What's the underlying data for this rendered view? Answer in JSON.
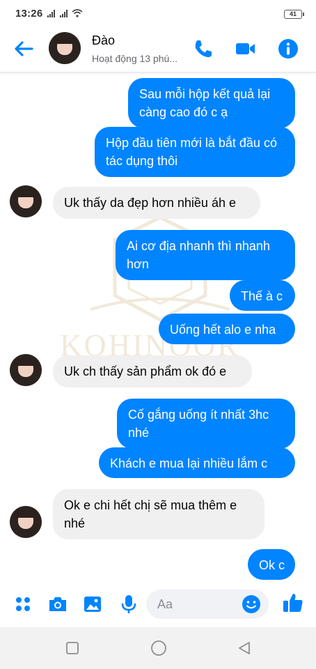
{
  "status_bar": {
    "time": "13:26",
    "battery": "41"
  },
  "header": {
    "contact_name": "Đào",
    "activity": "Hoạt động 13 phú..."
  },
  "messages": [
    {
      "side": "out",
      "text": "Sau mỗi hộp kết quả lại càng cao đó c ạ"
    },
    {
      "side": "out",
      "text": "Hộp đầu tiên mới là bắt đầu có tác dụng thôi"
    },
    {
      "side": "in",
      "text": "Uk thấy da đẹp hơn nhiều áh e"
    },
    {
      "side": "out",
      "text": "Ai cơ địa nhanh thì nhanh hơn"
    },
    {
      "side": "out",
      "text": "Thế à c"
    },
    {
      "side": "out",
      "text": "Uống hết alo e nha"
    },
    {
      "side": "in",
      "text": "Uk ch thấy sản phẩm ok đó e"
    },
    {
      "side": "out",
      "text": "Cố gắng uống ít nhất 3hc nhé"
    },
    {
      "side": "out",
      "text": "Khách e mua lại nhiều lắm c"
    },
    {
      "side": "in",
      "text": "Ok e chi hết chị sẽ mua thêm e nhé"
    },
    {
      "side": "out",
      "text": "Ok c"
    }
  ],
  "watermark": {
    "text": "KOHINOOR"
  },
  "composer": {
    "placeholder": "Aa"
  },
  "icons": {
    "back": "back-arrow-icon",
    "phone": "phone-icon",
    "video": "video-camera-icon",
    "info": "info-icon",
    "menu": "menu-dots-icon",
    "camera": "camera-icon",
    "gallery": "gallery-icon",
    "mic": "microphone-icon",
    "emoji": "emoji-icon",
    "like": "thumbs-up-icon"
  },
  "colors": {
    "accent": "#0084ff",
    "incoming_bubble": "#f1f0f0",
    "outgoing_text": "#ffffff"
  }
}
